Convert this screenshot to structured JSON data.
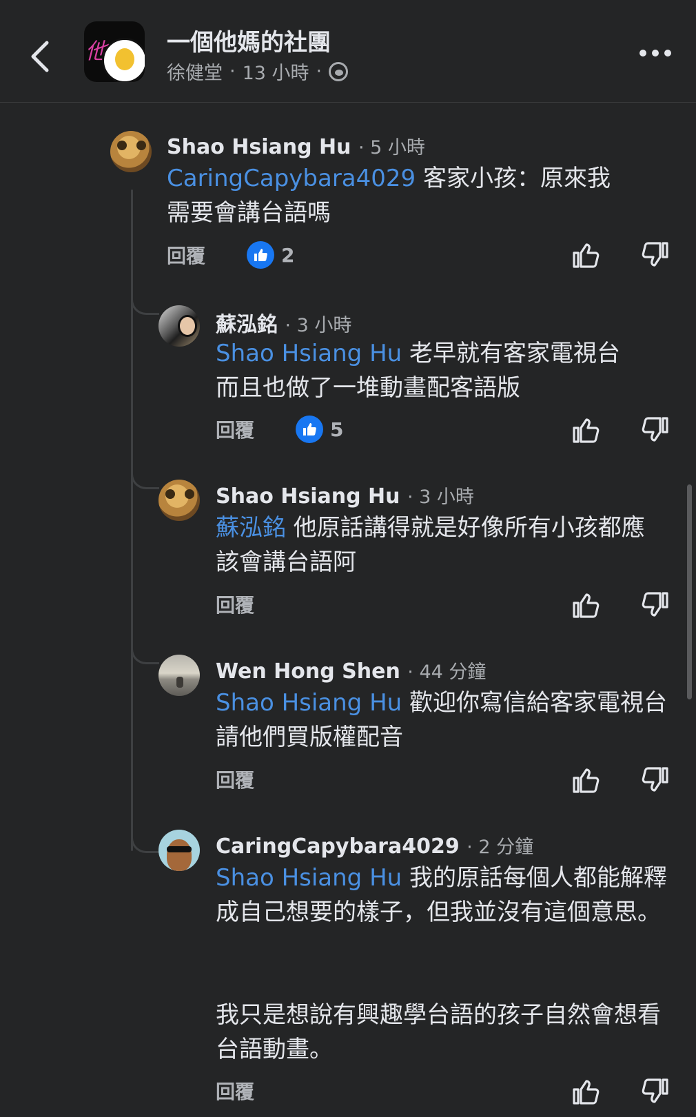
{
  "header": {
    "group_name": "一個他媽的社團",
    "poster": "徐健堂",
    "separator": "·",
    "post_time": "13 小時",
    "avatar_text": "他媽"
  },
  "comments": [
    {
      "author": "Shao Hsiang Hu",
      "time": "· 5 小時",
      "mention": "CaringCapybara4029",
      "text": " 客家小孩：原來我需要會講台語嗎",
      "reply_label": "回覆",
      "likes": "2"
    },
    {
      "author": "蘇泓銘",
      "time": "· 3 小時",
      "mention": "Shao Hsiang Hu",
      "text": " 老早就有客家電視台 而且也做了一堆動畫配客語版",
      "reply_label": "回覆",
      "likes": "5"
    },
    {
      "author": "Shao Hsiang Hu",
      "time": "· 3 小時",
      "mention": "蘇泓銘",
      "text": " 他原話講得就是好像所有小孩都應該會講台語阿",
      "reply_label": "回覆",
      "likes": ""
    },
    {
      "author": "Wen Hong Shen",
      "time": "· 44 分鐘",
      "mention": "Shao Hsiang Hu",
      "text": " 歡迎你寫信給客家電視台 請他們買版權配音",
      "reply_label": "回覆",
      "likes": ""
    },
    {
      "author": "CaringCapybara4029",
      "time": "· 2 分鐘",
      "mention": "Shao Hsiang Hu",
      "text": " 我的原話每個人都能解釋成自己想要的樣子，但我並沒有這個意思。",
      "text2": "我只是想說有興趣學台語的孩子自然會想看台語動畫。",
      "reply_label": "回覆",
      "likes": ""
    }
  ],
  "colors": {
    "background": "#242526",
    "text": "#e4e6eb",
    "secondary": "#a8abaf",
    "mention": "#4a90e2",
    "like_badge": "#1877f2"
  }
}
